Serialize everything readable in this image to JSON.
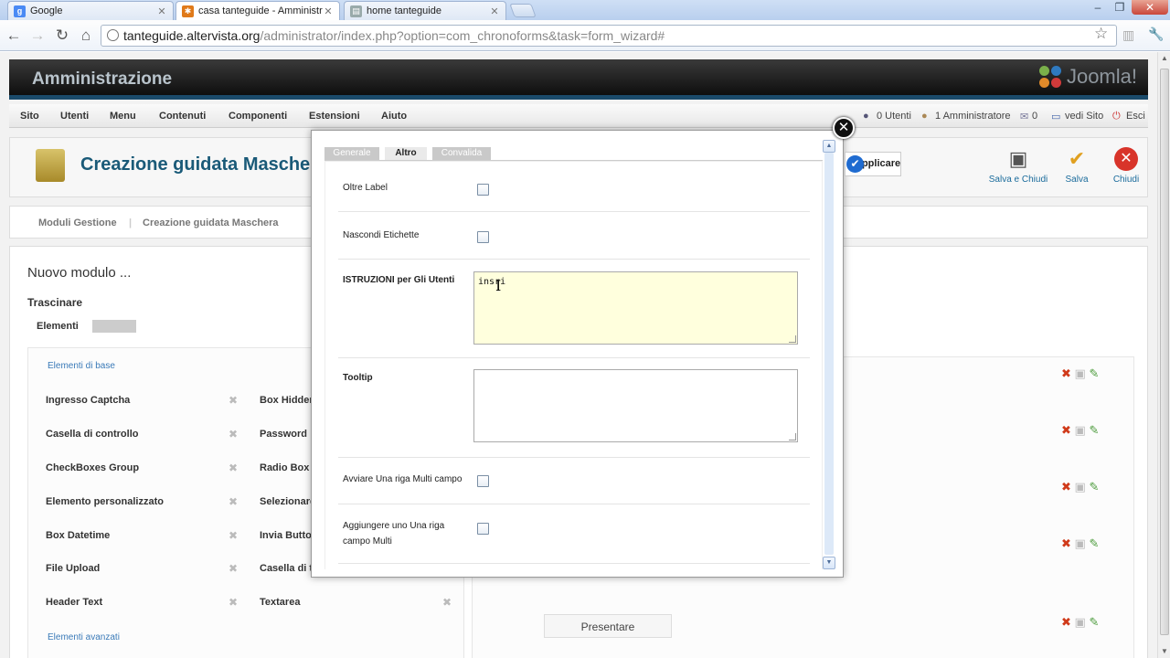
{
  "browser": {
    "tabs": [
      {
        "title": "Google",
        "icon": "google-favicon"
      },
      {
        "title": "casa tanteguide - Amministrazi",
        "icon": "joomla-favicon"
      },
      {
        "title": "home tanteguide",
        "icon": "page-favicon"
      }
    ],
    "url_host": "tanteguide.altervista.org",
    "url_path": "/administrator/index.php?option=com_chronoforms&task=form_wizard#"
  },
  "header": {
    "title": "Amministrazione",
    "logo_text": "Joomla!"
  },
  "menu": {
    "items": [
      "Sito",
      "Utenti",
      "Menu",
      "Contenuti",
      "Componenti",
      "Estensioni",
      "Aiuto"
    ],
    "status": [
      "0 Utenti",
      "1 Amministratore",
      "0",
      "vedi Sito",
      "Esci"
    ]
  },
  "toolbar": {
    "page_title": "Creazione guidata Maschera",
    "save_close": "Salva e Chiudi",
    "save": "Salva",
    "close": "Chiudi"
  },
  "submenu": {
    "items": [
      "Moduli Gestione",
      "Creazione guidata Maschera"
    ]
  },
  "content": {
    "title": "Nuovo modulo ...",
    "subtitle": "Trascinare",
    "tab_elements": "Elementi",
    "group_basic": "Elementi di base",
    "group_advanced": "Elementi avanzati",
    "elements_left": [
      "Ingresso Captcha",
      "Casella di controllo",
      "CheckBoxes Group",
      "Elemento personalizzato",
      "Box Datetime",
      "File Upload",
      "Header Text"
    ],
    "elements_right": [
      "Box Hidden",
      "Password",
      "Radio Box",
      "Selezionare",
      "Invia Button",
      "Casella di t",
      "Textarea"
    ],
    "submit_button": "Presentare"
  },
  "modal": {
    "tabs": [
      "Generale",
      "Altro",
      "Convalida"
    ],
    "active_tab": "Altro",
    "fields": {
      "oltre_label": "Oltre Label",
      "nascondi": "Nascondi Etichette",
      "istruzioni": "ISTRUZIONI per Gli Utenti",
      "istruzioni_value": "insri",
      "tooltip": "Tooltip",
      "tooltip_value": "",
      "avviare": "Avviare Una riga Multi campo",
      "aggiungere": "Aggiungere uno Una riga campo Multi"
    },
    "apply_button": "Applicare"
  }
}
